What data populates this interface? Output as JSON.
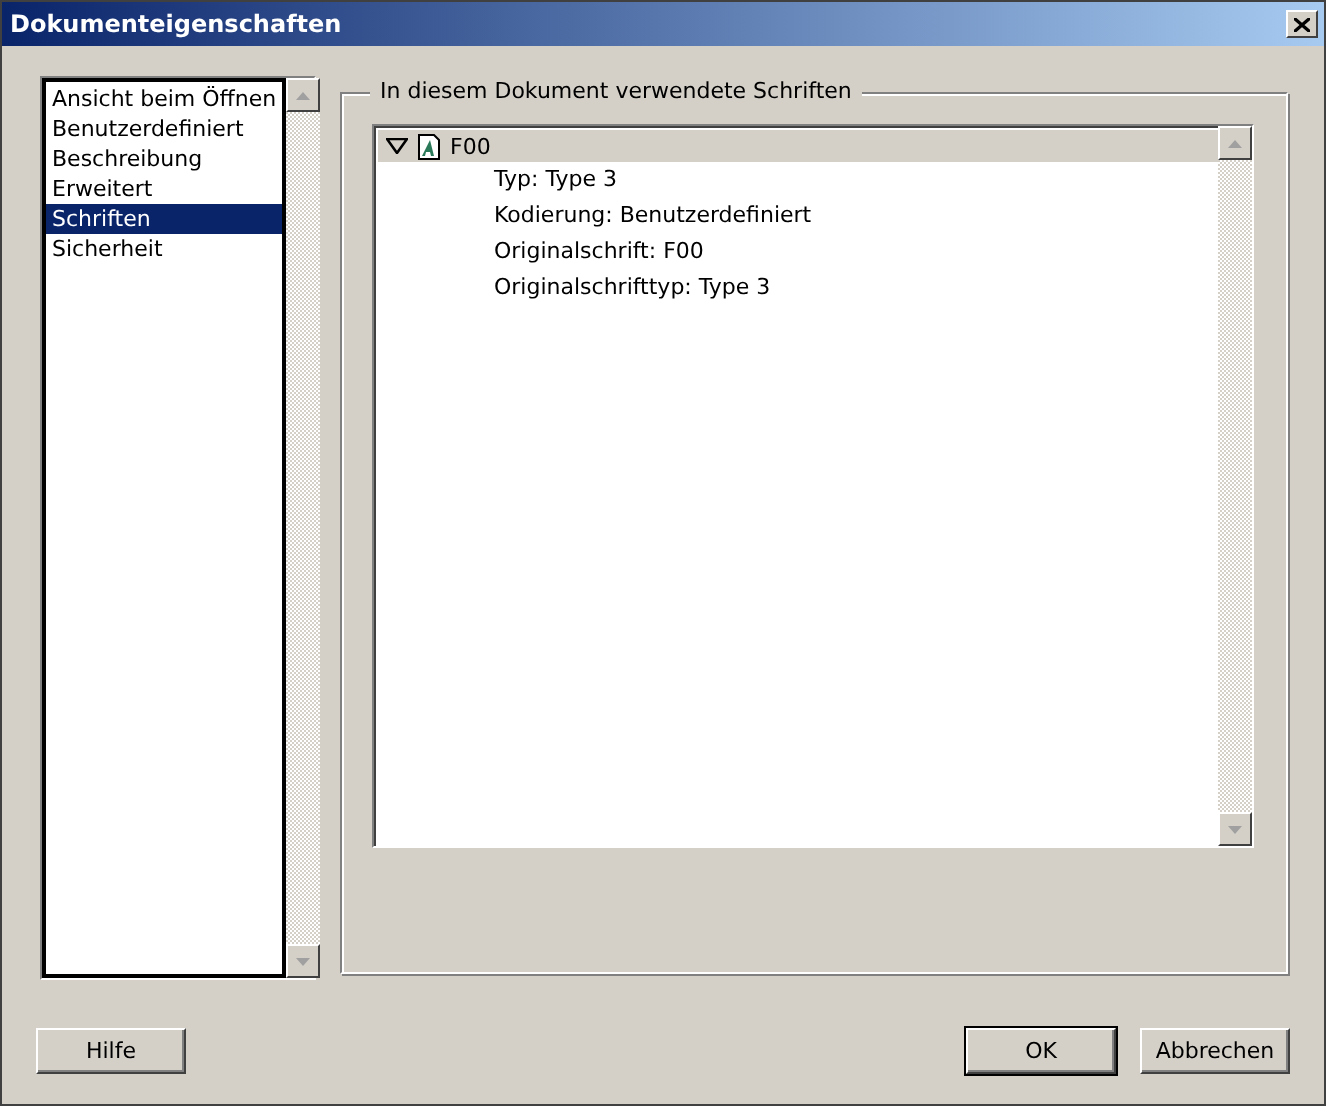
{
  "window": {
    "title": "Dokumenteigenschaften"
  },
  "sidebar": {
    "items": [
      {
        "label": "Ansicht beim Öffnen",
        "selected": false
      },
      {
        "label": "Benutzerdefiniert",
        "selected": false
      },
      {
        "label": "Beschreibung",
        "selected": false
      },
      {
        "label": "Erweitert",
        "selected": false
      },
      {
        "label": "Schriften",
        "selected": true
      },
      {
        "label": "Sicherheit",
        "selected": false
      }
    ]
  },
  "fonts_group": {
    "title": "In diesem Dokument verwendete Schriften",
    "tree": [
      {
        "label": "F00",
        "expanded": true,
        "children": [
          {
            "label": "Typ: Type 3"
          },
          {
            "label": "Kodierung: Benutzerdefiniert"
          },
          {
            "label": "Originalschrift: F00"
          },
          {
            "label": "Originalschrifttyp: Type 3"
          }
        ]
      }
    ]
  },
  "footer": {
    "left_buttons": [
      {
        "label": "Hilfe",
        "default": false
      }
    ],
    "right_buttons": [
      {
        "label": "OK",
        "default": true
      },
      {
        "label": "Abbrechen",
        "default": false
      }
    ]
  }
}
